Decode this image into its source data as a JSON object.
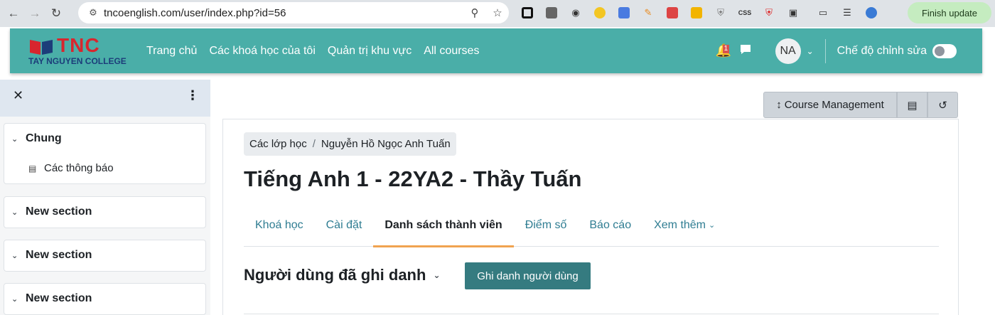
{
  "browser": {
    "url": "tncoenglish.com/user/index.php?id=56",
    "finish_update_label": "Finish update",
    "extensions": [
      "qr-code-icon",
      "image-icon",
      "camera-icon",
      "emoji-extension-icon",
      "document-icon",
      "pencil-icon",
      "screenshot-icon",
      "clipboard-icon",
      "shield-icon",
      "css-icon",
      "red-shield-icon",
      "puzzle-icon",
      "cast-icon",
      "media-playlist-icon",
      "globe-icon"
    ],
    "css_ext_label": "CSS"
  },
  "site": {
    "logo_text": "TNC",
    "logo_subtitle": "TAY NGUYEN COLLEGE",
    "brand_color": "#4aaea8",
    "primary_nav": [
      "Trang chủ",
      "Các khoá học của tôi",
      "Quản trị khu vực",
      "All courses"
    ],
    "notification_count": "1",
    "avatar_initials": "NA",
    "edit_mode_label": "Chế độ chỉnh sửa",
    "edit_mode_on": false
  },
  "course_index": {
    "sections": [
      {
        "title": "Chung",
        "items": [
          "Các thông báo"
        ]
      },
      {
        "title": "New section",
        "items": []
      },
      {
        "title": "New section",
        "items": []
      },
      {
        "title": "New section",
        "items": []
      }
    ]
  },
  "header_actions": {
    "course_management_label": "Course Management"
  },
  "main": {
    "breadcrumb": [
      "Các lớp học",
      "Nguyễn Hồ Ngọc Anh Tuấn"
    ],
    "title": "Tiếng Anh 1 - 22YA2 - Thầy Tuấn",
    "tabs": [
      {
        "label": "Khoá học",
        "active": false
      },
      {
        "label": "Cài đặt",
        "active": false
      },
      {
        "label": "Danh sách thành viên",
        "active": true
      },
      {
        "label": "Điểm số",
        "active": false
      },
      {
        "label": "Báo cáo",
        "active": false
      },
      {
        "label": "Xem thêm",
        "active": false
      }
    ],
    "enrol_select_label": "Người dùng đã ghi danh",
    "enrol_button_label": "Ghi danh người dùng",
    "accent_color": "#f0a350",
    "button_color": "#357b80"
  }
}
